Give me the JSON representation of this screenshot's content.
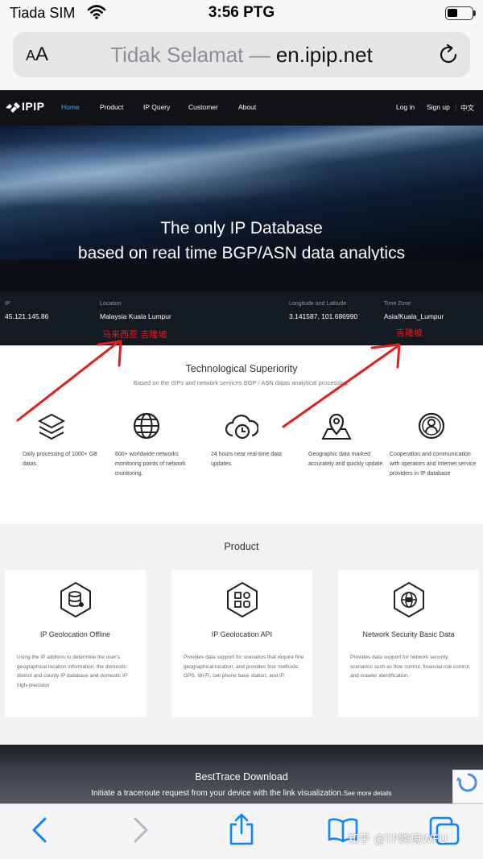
{
  "status_bar": {
    "carrier": "Tiada SIM",
    "time": "3:56 PTG"
  },
  "browser": {
    "text_size_label": "AA",
    "url_insecure_label": "Tidak Selamat —",
    "url_domain": "en.ipip.net"
  },
  "site": {
    "logo": "IPIP",
    "nav": {
      "home": "Home",
      "product": "Product",
      "ip_query": "IP Query",
      "customer": "Customer",
      "about": "About",
      "login": "Log in",
      "signup": "Sign up",
      "separator": "|",
      "lang": "中文"
    },
    "hero": {
      "line1": "The only IP Database",
      "line2": "based on real time BGP/ASN data analytics"
    },
    "info": {
      "ip_label": "IP",
      "ip_value": "45.121.145.86",
      "location_label": "Location",
      "location_value": "Malaysia Kuala Lumpur",
      "lonlat_label": "Longitude and Latitude",
      "lonlat_value": "3.141587, 101.686990",
      "tz_label": "Time Zone",
      "tz_value": "Asia/Kuala_Lumpur"
    },
    "annotations": {
      "location_note": "马来西亚  吉隆坡",
      "tz_note": "吉隆坡",
      "arrow_color": "#e02020"
    },
    "tech": {
      "title": "Technological Superiority",
      "subtitle": "Based on the ISPs and network services BGP / ASN datas analytical processing.",
      "features": [
        {
          "icon": "layers-icon",
          "text": "Daily processing of 1000+ GB datas."
        },
        {
          "icon": "globe-icon",
          "text": "600+ worldwide networks monitoring points of network monitoring."
        },
        {
          "icon": "cloud-clock-icon",
          "text": "24 hours near real-time data updates."
        },
        {
          "icon": "map-pin-icon",
          "text": "Geographic data marked accurately and quickly update."
        },
        {
          "icon": "person-badge-icon",
          "text": "Cooperation and communication with operators and Internet service providers in IP database"
        }
      ]
    },
    "product": {
      "title": "Product",
      "cards": [
        {
          "icon": "database-icon",
          "title": "IP Geolocation Offline",
          "desc": "Using the IP address to determine the user's geographical location information, the domestic district and county IP database and domestic IP high-precision"
        },
        {
          "icon": "api-grid-icon",
          "title": "IP Geolocation API",
          "desc": "Provides data support for scenarios that require fine geographical location, and provides four methods: GPS, Wi-Fi, cell phone base station, and IP."
        },
        {
          "icon": "secure-globe-icon",
          "title": "Network Security Basic Data",
          "desc": "Provides data support for network security scenarios such as flow control, financial risk control, and crawler identification."
        }
      ]
    },
    "besttrace": {
      "title": "BestTrace Download",
      "desc": "Initiate a traceroute request from your device with the link visualization.",
      "more": "See more details"
    }
  },
  "watermark": "知乎 @TP跨境WFU",
  "colors": {
    "accent": "#4aa3ff",
    "ios_blue": "#0a84ff",
    "nav_bg": "#101216"
  }
}
